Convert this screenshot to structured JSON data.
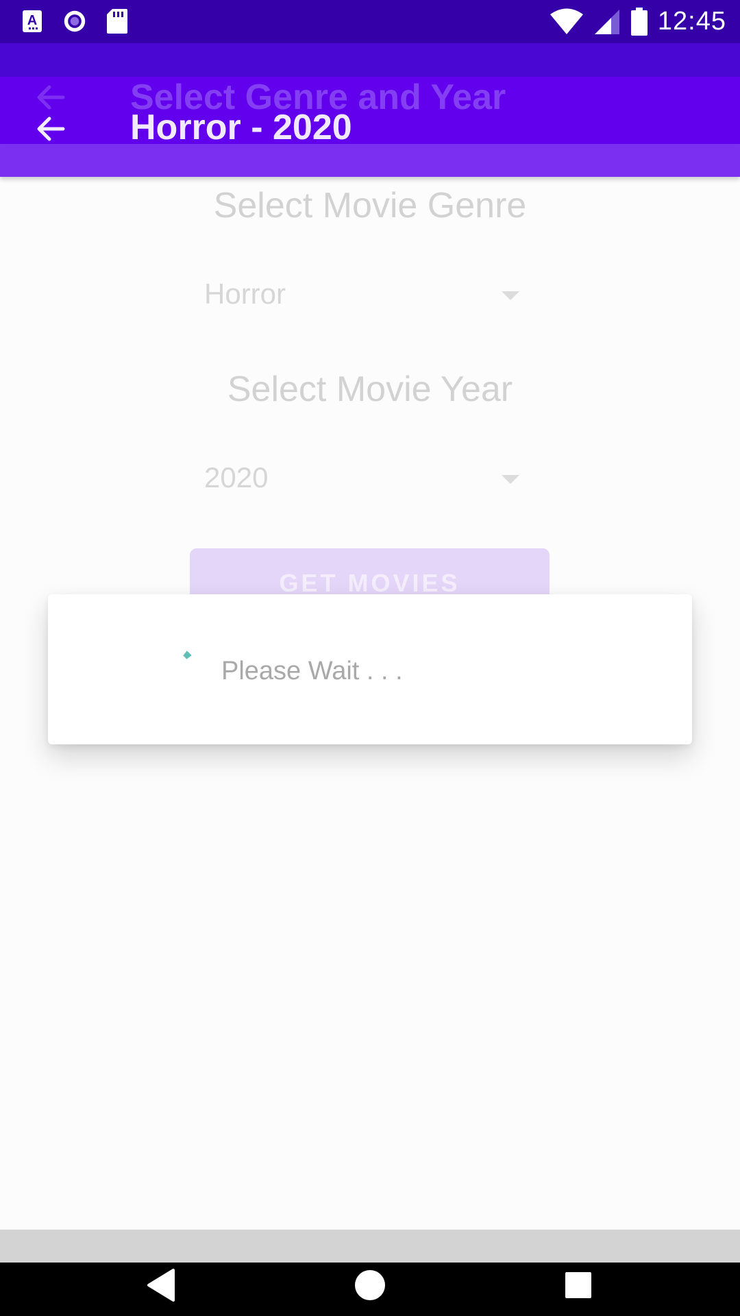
{
  "status_bar": {
    "time": "12:45",
    "left_icons": [
      "a-notification-icon",
      "radio-circle-icon",
      "sd-card-icon"
    ],
    "right_icons": [
      "wifi-icon",
      "cell-signal-icon",
      "battery-icon"
    ]
  },
  "app_bar": {
    "previous_title": "Select Genre and Year",
    "title": "Horror - 2020",
    "back_icon": "arrow-back-icon"
  },
  "form": {
    "genre_label": "Select Movie Genre",
    "genre_value": "Horror",
    "year_label": "Select Movie Year",
    "year_value": "2020",
    "button_label": "GET MOVIES"
  },
  "dialog": {
    "message": "Please Wait . . ."
  },
  "nav_bar": {
    "icons": [
      "back-triangle-icon",
      "home-circle-icon",
      "recents-square-icon"
    ]
  },
  "colors": {
    "status_bar": "#3600a8",
    "primary": "#6200ee",
    "accent": "#5fbfb5"
  }
}
